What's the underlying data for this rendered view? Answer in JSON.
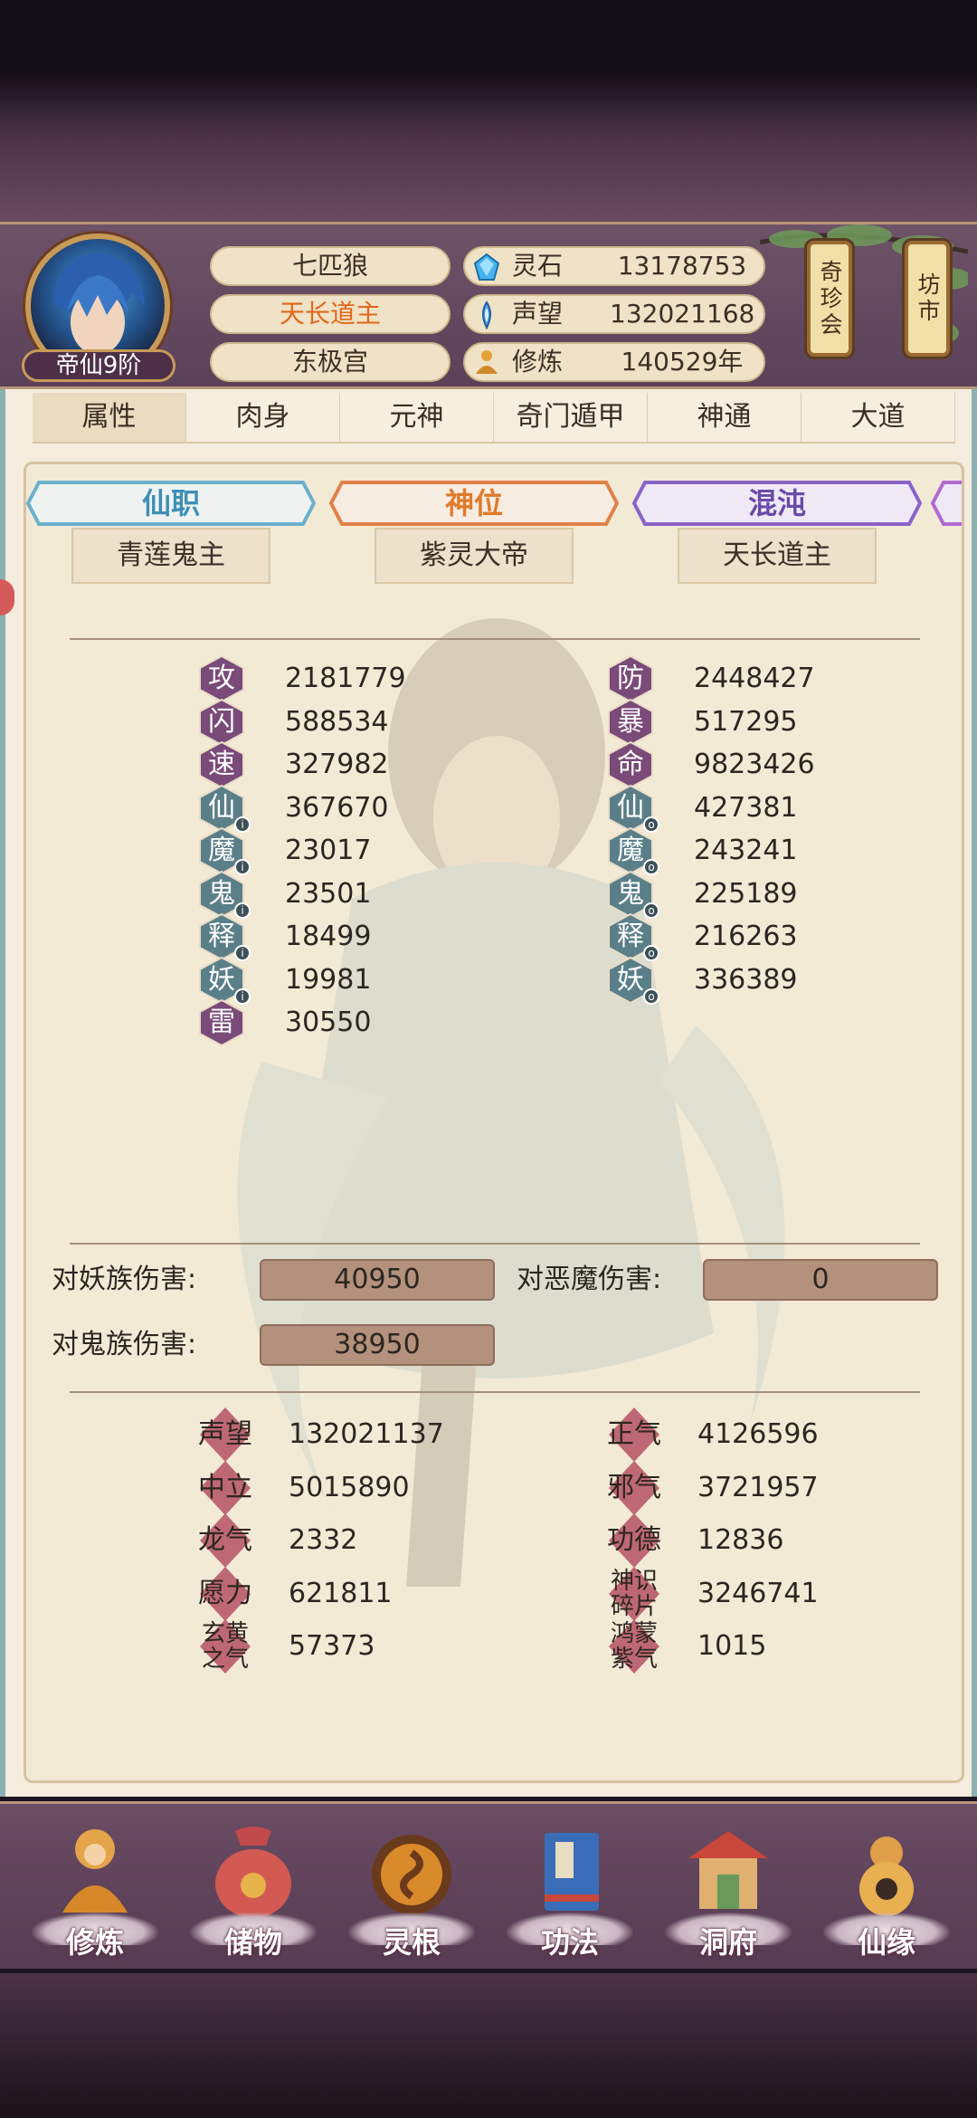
{
  "header": {
    "rank": "帝仙9阶",
    "names": [
      "七匹狼",
      "天长道主",
      "东极宫"
    ],
    "resources": [
      {
        "icon": "spirit-stone-icon",
        "label": "灵石",
        "value": "13178753"
      },
      {
        "icon": "reputation-icon",
        "label": "声望",
        "value": "132021168"
      },
      {
        "icon": "cultivation-icon",
        "label": "修炼",
        "value": "140529年"
      }
    ],
    "buttons": [
      "奇珍会",
      "坊市"
    ]
  },
  "tabs": [
    "属性",
    "肉身",
    "元神",
    "奇门遁甲",
    "神通",
    "大道"
  ],
  "titles": [
    {
      "label": "仙职",
      "value": "青莲鬼主",
      "color": "#3f8fb5"
    },
    {
      "label": "神位",
      "value": "紫灵大帝",
      "color": "#e07a2a"
    },
    {
      "label": "混沌",
      "value": "天长道主",
      "color": "#7a5ab8"
    }
  ],
  "stats_left": [
    {
      "glyph": "攻",
      "value": "2181779",
      "badge": ""
    },
    {
      "glyph": "闪",
      "value": "588534",
      "badge": ""
    },
    {
      "glyph": "速",
      "value": "327982",
      "badge": ""
    },
    {
      "glyph": "仙",
      "value": "367670",
      "badge": "i"
    },
    {
      "glyph": "魔",
      "value": "23017",
      "badge": "i"
    },
    {
      "glyph": "鬼",
      "value": "23501",
      "badge": "i"
    },
    {
      "glyph": "释",
      "value": "18499",
      "badge": "i"
    },
    {
      "glyph": "妖",
      "value": "19981",
      "badge": "i"
    },
    {
      "glyph": "雷",
      "value": "30550",
      "badge": ""
    }
  ],
  "stats_right": [
    {
      "glyph": "防",
      "value": "2448427",
      "badge": ""
    },
    {
      "glyph": "暴",
      "value": "517295",
      "badge": ""
    },
    {
      "glyph": "命",
      "value": "9823426",
      "badge": ""
    },
    {
      "glyph": "仙",
      "value": "427381",
      "badge": "o"
    },
    {
      "glyph": "魔",
      "value": "243241",
      "badge": "o"
    },
    {
      "glyph": "鬼",
      "value": "225189",
      "badge": "o"
    },
    {
      "glyph": "释",
      "value": "216263",
      "badge": "o"
    },
    {
      "glyph": "妖",
      "value": "336389",
      "badge": "o"
    }
  ],
  "damage": [
    {
      "label": "对妖族伤害:",
      "value": "40950"
    },
    {
      "label": "对恶魔伤害:",
      "value": "0"
    },
    {
      "label": "对鬼族伤害:",
      "value": "38950"
    }
  ],
  "attributes_left": [
    {
      "name": "声望",
      "value": "132021137"
    },
    {
      "name": "中立",
      "value": "5015890"
    },
    {
      "name": "龙气",
      "value": "2332"
    },
    {
      "name": "愿力",
      "value": "621811"
    },
    {
      "name": "玄黄之气",
      "value": "57373"
    }
  ],
  "attributes_right": [
    {
      "name": "正气",
      "value": "4126596"
    },
    {
      "name": "邪气",
      "value": "3721957"
    },
    {
      "name": "功德",
      "value": "12836"
    },
    {
      "name": "神识碎片",
      "value": "3246741"
    },
    {
      "name": "鸿蒙紫气",
      "value": "1015"
    }
  ],
  "nav": [
    "修炼",
    "储物",
    "灵根",
    "功法",
    "洞府",
    "仙缘"
  ]
}
